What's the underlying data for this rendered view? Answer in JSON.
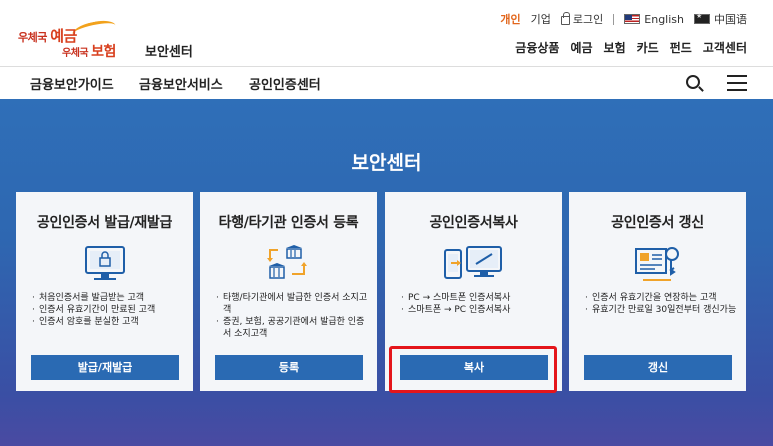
{
  "logo": {
    "line1_prefix": "우체국",
    "line1_main": "예금",
    "line2_prefix": "우체국",
    "line2_main": "보험"
  },
  "site_title": "보안센터",
  "util": {
    "personal": "개인",
    "corporate": "기업",
    "login": "로그인",
    "english": "English",
    "chinese": "中国语"
  },
  "top_nav": [
    "금융상품",
    "예금",
    "보험",
    "카드",
    "펀드",
    "고객센터"
  ],
  "main_nav": [
    "금융보안가이드",
    "금융보안서비스",
    "공인인증센터"
  ],
  "hero_title": "보안센터",
  "cards": [
    {
      "title": "공인인증서 발급/재발급",
      "icon": "computer-lock-icon",
      "desc": [
        "처음인증서를 발급받는 고객",
        "인증서 유효기간이 만료된 고객",
        "인증서 암호를 분실한 고객"
      ],
      "button": "발급/재발급"
    },
    {
      "title": "타행/타기관 인증서 등록",
      "icon": "bank-transfer-icon",
      "desc": [
        "타행/타기관에서 발급한 인증서 소지고객",
        "증권, 보험, 공공기관에서 발급한 인증서 소지고객"
      ],
      "button": "등록"
    },
    {
      "title": "공인인증서복사",
      "icon": "phone-pc-copy-icon",
      "desc": [
        "PC → 스마트폰 인증서복사",
        "스마트폰 → PC 인증서복사"
      ],
      "button": "복사"
    },
    {
      "title": "공인인증서 갱신",
      "icon": "certificate-renew-icon",
      "desc": [
        "인증서 유효기간을 연장하는 고객",
        "유효기간 만료일 30일전부터 갱신가능"
      ],
      "button": "갱신"
    }
  ],
  "colors": {
    "accent": "#2a6ab3",
    "hero_top": "#2f6fb8",
    "hero_bottom": "#4a4aa2",
    "active_util": "#e2661c",
    "highlight": "#e4151b"
  }
}
